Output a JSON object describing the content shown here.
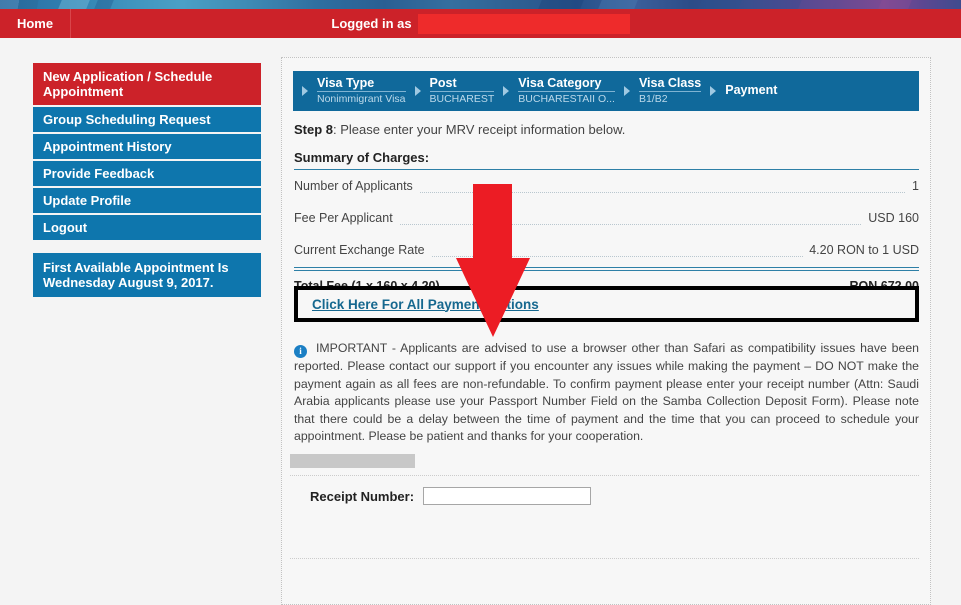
{
  "header": {
    "home_label": "Home",
    "logged_in_label": "Logged in as",
    "logged_in_value": "",
    "bar_color": "#cc2229"
  },
  "sidebar": {
    "items": [
      {
        "label": "New Application / Schedule Appointment",
        "active": true
      },
      {
        "label": "Group Scheduling Request",
        "active": false
      },
      {
        "label": "Appointment History",
        "active": false
      },
      {
        "label": "Provide Feedback",
        "active": false
      },
      {
        "label": "Update Profile",
        "active": false
      },
      {
        "label": "Logout",
        "active": false
      }
    ],
    "notice": "First Available Appointment Is Wednesday August 9, 2017.",
    "active_color": "#cc2229",
    "item_color": "#0e76ad"
  },
  "breadcrumb": {
    "steps": [
      {
        "title": "Visa Type",
        "sub": "Nonimmigrant Visa"
      },
      {
        "title": "Post",
        "sub": "BUCHAREST"
      },
      {
        "title": "Visa Category",
        "sub": "BUCHARESTAII O..."
      },
      {
        "title": "Visa Class",
        "sub": "B1/B2"
      },
      {
        "title": "Payment",
        "sub": ""
      }
    ],
    "bg_color": "#10699b"
  },
  "main": {
    "step_label": "Step 8",
    "step_text": ": Please enter your MRV receipt information below.",
    "summary_title": "Summary of Charges:",
    "charges": [
      {
        "label": "Number of Applicants",
        "value": "1"
      },
      {
        "label": "Fee Per Applicant",
        "value": "USD 160"
      },
      {
        "label": "Current Exchange Rate",
        "value": "4.20 RON to 1 USD"
      }
    ],
    "total_label": "Total Fee (1 x 160 x 4.20)",
    "total_value": "RON 672.00",
    "payment_options_link": "Click Here For All Payment Options",
    "note_icon": "info-icon",
    "note_text": "IMPORTANT - Applicants are advised to use a browser other than Safari as compatibility issues have been reported. Please contact our support if you encounter any issues while making the payment – DO NOT make the payment again as all fees are non-refundable. To confirm payment please enter your receipt number (Attn: Saudi Arabia applicants please use your Passport Number Field on the Samba Collection Deposit Form). Please note that there could be a delay between the time of payment and the time that you can proceed to schedule your appointment. Please be patient and thanks for your cooperation.",
    "receipt_label": "Receipt Number:",
    "receipt_value": "",
    "receipt_placeholder": ""
  },
  "annotation": {
    "arrow_color": "#ec1c24",
    "arrow_points_to": "Click Here For All Payment Options"
  }
}
